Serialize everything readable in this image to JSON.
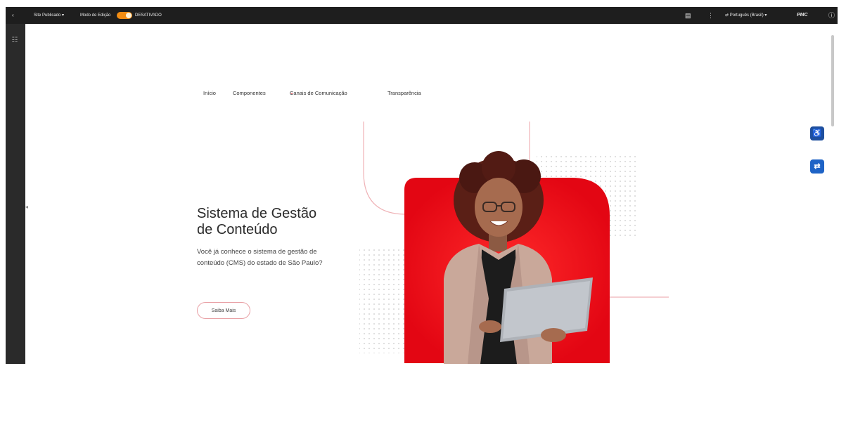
{
  "topbar": {
    "back_icon": "chevron-left-icon",
    "site_label": "Site Publicado",
    "edit_mode_label": "Modo de Edição",
    "edit_mode_on": true,
    "edit_mode_state": "DESATIVADO",
    "language": "Português (Brasil)",
    "brand": "PMC",
    "page_icon": "page-icon",
    "more_icon": "more-icon",
    "info_icon": "info-icon"
  },
  "nav": {
    "items": [
      {
        "label": "Início"
      },
      {
        "label": "Componentes"
      },
      {
        "label": "Canais de Comunicação",
        "has_dropdown": true
      },
      {
        "label": "Transparência"
      }
    ]
  },
  "hero": {
    "title_line1": "Sistema de Gestão",
    "title_line2": "de Conteúdo",
    "description": "Você já conhece o sistema de gestão de conteúdo (CMS) do estado de São Paulo?",
    "cta_label": "Saiba Mais"
  },
  "floating": {
    "accessibility_icon": "accessibility-icon",
    "translate_icon": "translate-icon"
  },
  "colors": {
    "accent": "#e30613",
    "toggle": "#f28c12",
    "fab": "#1e63c6"
  }
}
